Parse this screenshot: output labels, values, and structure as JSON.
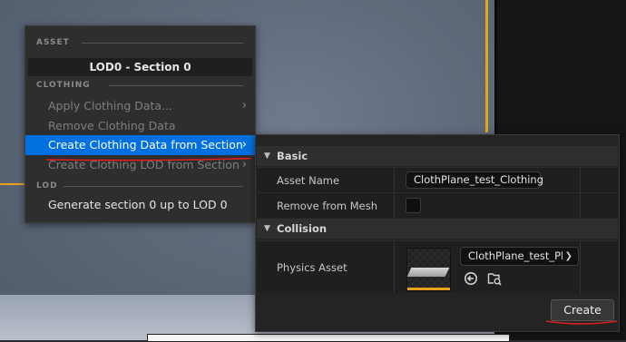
{
  "menu": {
    "section_asset": "ASSET",
    "lod_banner": "LOD0 - Section 0",
    "section_clothing": "CLOTHING",
    "items": [
      {
        "label": "Apply Clothing Data...",
        "has_submenu": true,
        "enabled": false
      },
      {
        "label": "Remove Clothing Data",
        "has_submenu": false,
        "enabled": false
      },
      {
        "label": "Create Clothing Data from Section",
        "has_submenu": true,
        "enabled": true,
        "highlighted": true
      },
      {
        "label": "Create Clothing LOD from Section",
        "has_submenu": true,
        "enabled": false
      }
    ],
    "section_lod": "LOD",
    "lod_item": "Generate section 0 up to LOD 0",
    "chevron": "›"
  },
  "panel": {
    "basic": {
      "title": "Basic",
      "asset_name_label": "Asset Name",
      "asset_name_value": "ClothPlane_test_Clothing",
      "remove_from_mesh_label": "Remove from Mesh",
      "remove_from_mesh_checked": false
    },
    "collision": {
      "title": "Collision",
      "physics_asset_label": "Physics Asset",
      "physics_asset_value": "ClothPlane_test_Ph"
    },
    "create_button": "Create",
    "icons": {
      "expand": "triangle-down-icon",
      "use_selected": "arrow-left-circle-icon",
      "browse": "folder-search-icon",
      "dropdown": "chevron-down-icon"
    }
  },
  "colors": {
    "highlight": "#0070e0",
    "accent_orange": "#e9a21c",
    "annotation_red": "#e02020"
  }
}
